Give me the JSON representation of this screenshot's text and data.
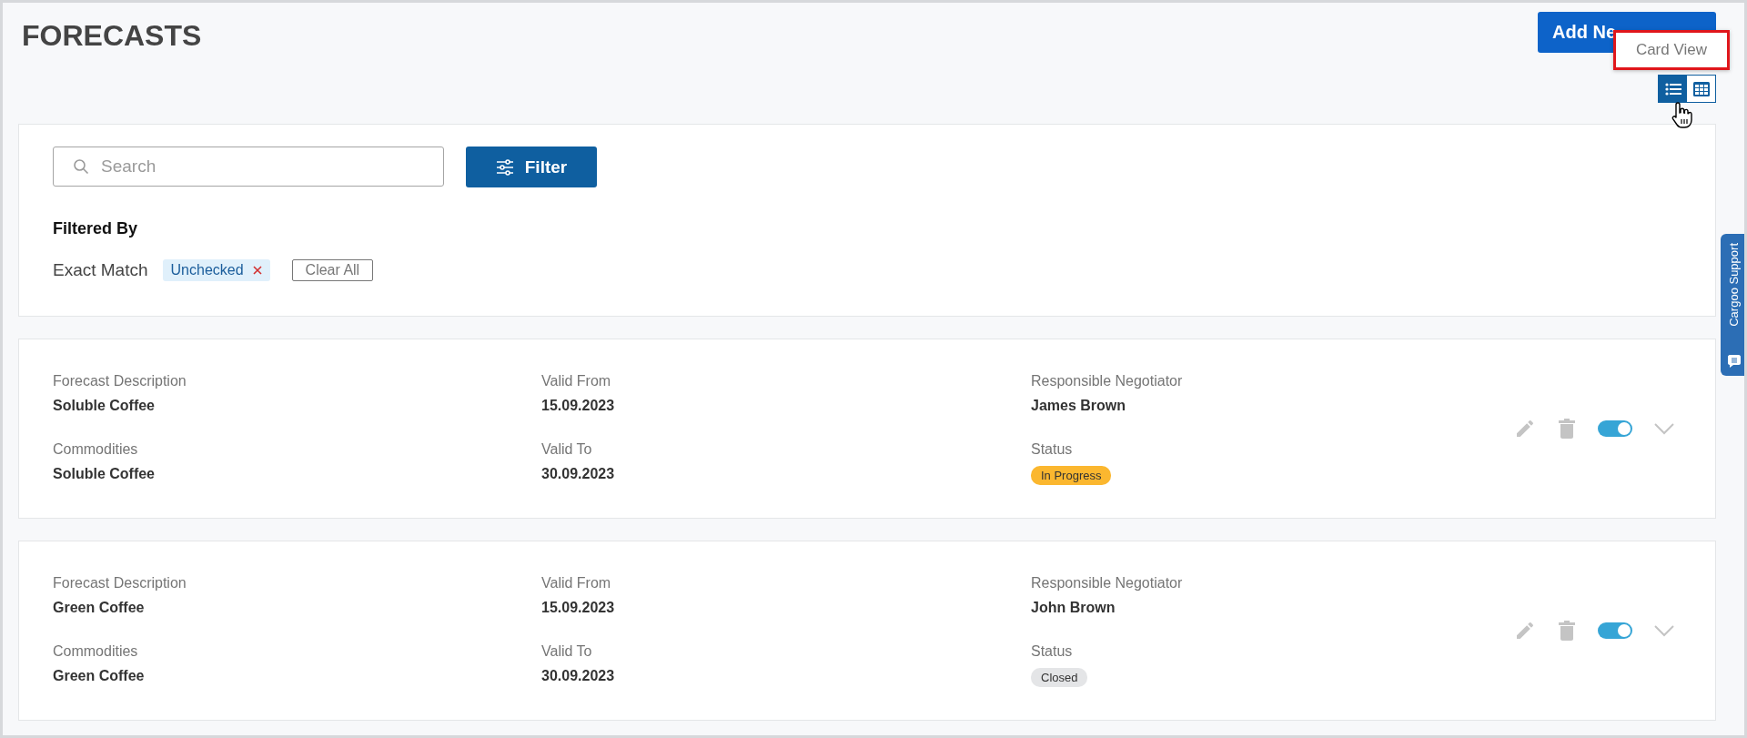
{
  "title": "FORECASTS",
  "add_button": {
    "label": "Add Ne"
  },
  "tooltip": {
    "text": "Card View",
    "highlighted": true
  },
  "view_toggle": [
    {
      "kind": "list",
      "selected": true
    },
    {
      "kind": "grid",
      "selected": false
    }
  ],
  "search": {
    "placeholder": "Search"
  },
  "filter_button": {
    "label": "Filter"
  },
  "filtered_by": {
    "heading": "Filtered By",
    "label": "Exact Match",
    "chips": [
      "Unchecked"
    ],
    "clear": "Clear All"
  },
  "cards": [
    {
      "fields": [
        {
          "label": "Forecast Description",
          "value": "Soluble Coffee"
        },
        {
          "label": "Valid From",
          "value": "15.09.2023"
        },
        {
          "label": "Responsible Negotiator",
          "value": "James Brown"
        },
        {
          "label": "Commodities",
          "value": "Soluble Coffee"
        },
        {
          "label": "Valid To",
          "value": "30.09.2023"
        }
      ],
      "status_label": "Status",
      "status": {
        "text": "In Progress",
        "color": "#fbb72f"
      },
      "on": true
    },
    {
      "fields": [
        {
          "label": "Forecast Description",
          "value": "Green Coffee"
        },
        {
          "label": "Valid From",
          "value": "15.09.2023"
        },
        {
          "label": "Responsible Negotiator",
          "value": "John Brown"
        },
        {
          "label": "Commodities",
          "value": "Green Coffee"
        },
        {
          "label": "Valid To",
          "value": "30.09.2023"
        }
      ],
      "status_label": "Status",
      "status": {
        "text": "Closed",
        "color": "#e4e5e7"
      },
      "on": true
    }
  ],
  "side_tab": {
    "label": "Cargoo Support"
  }
}
